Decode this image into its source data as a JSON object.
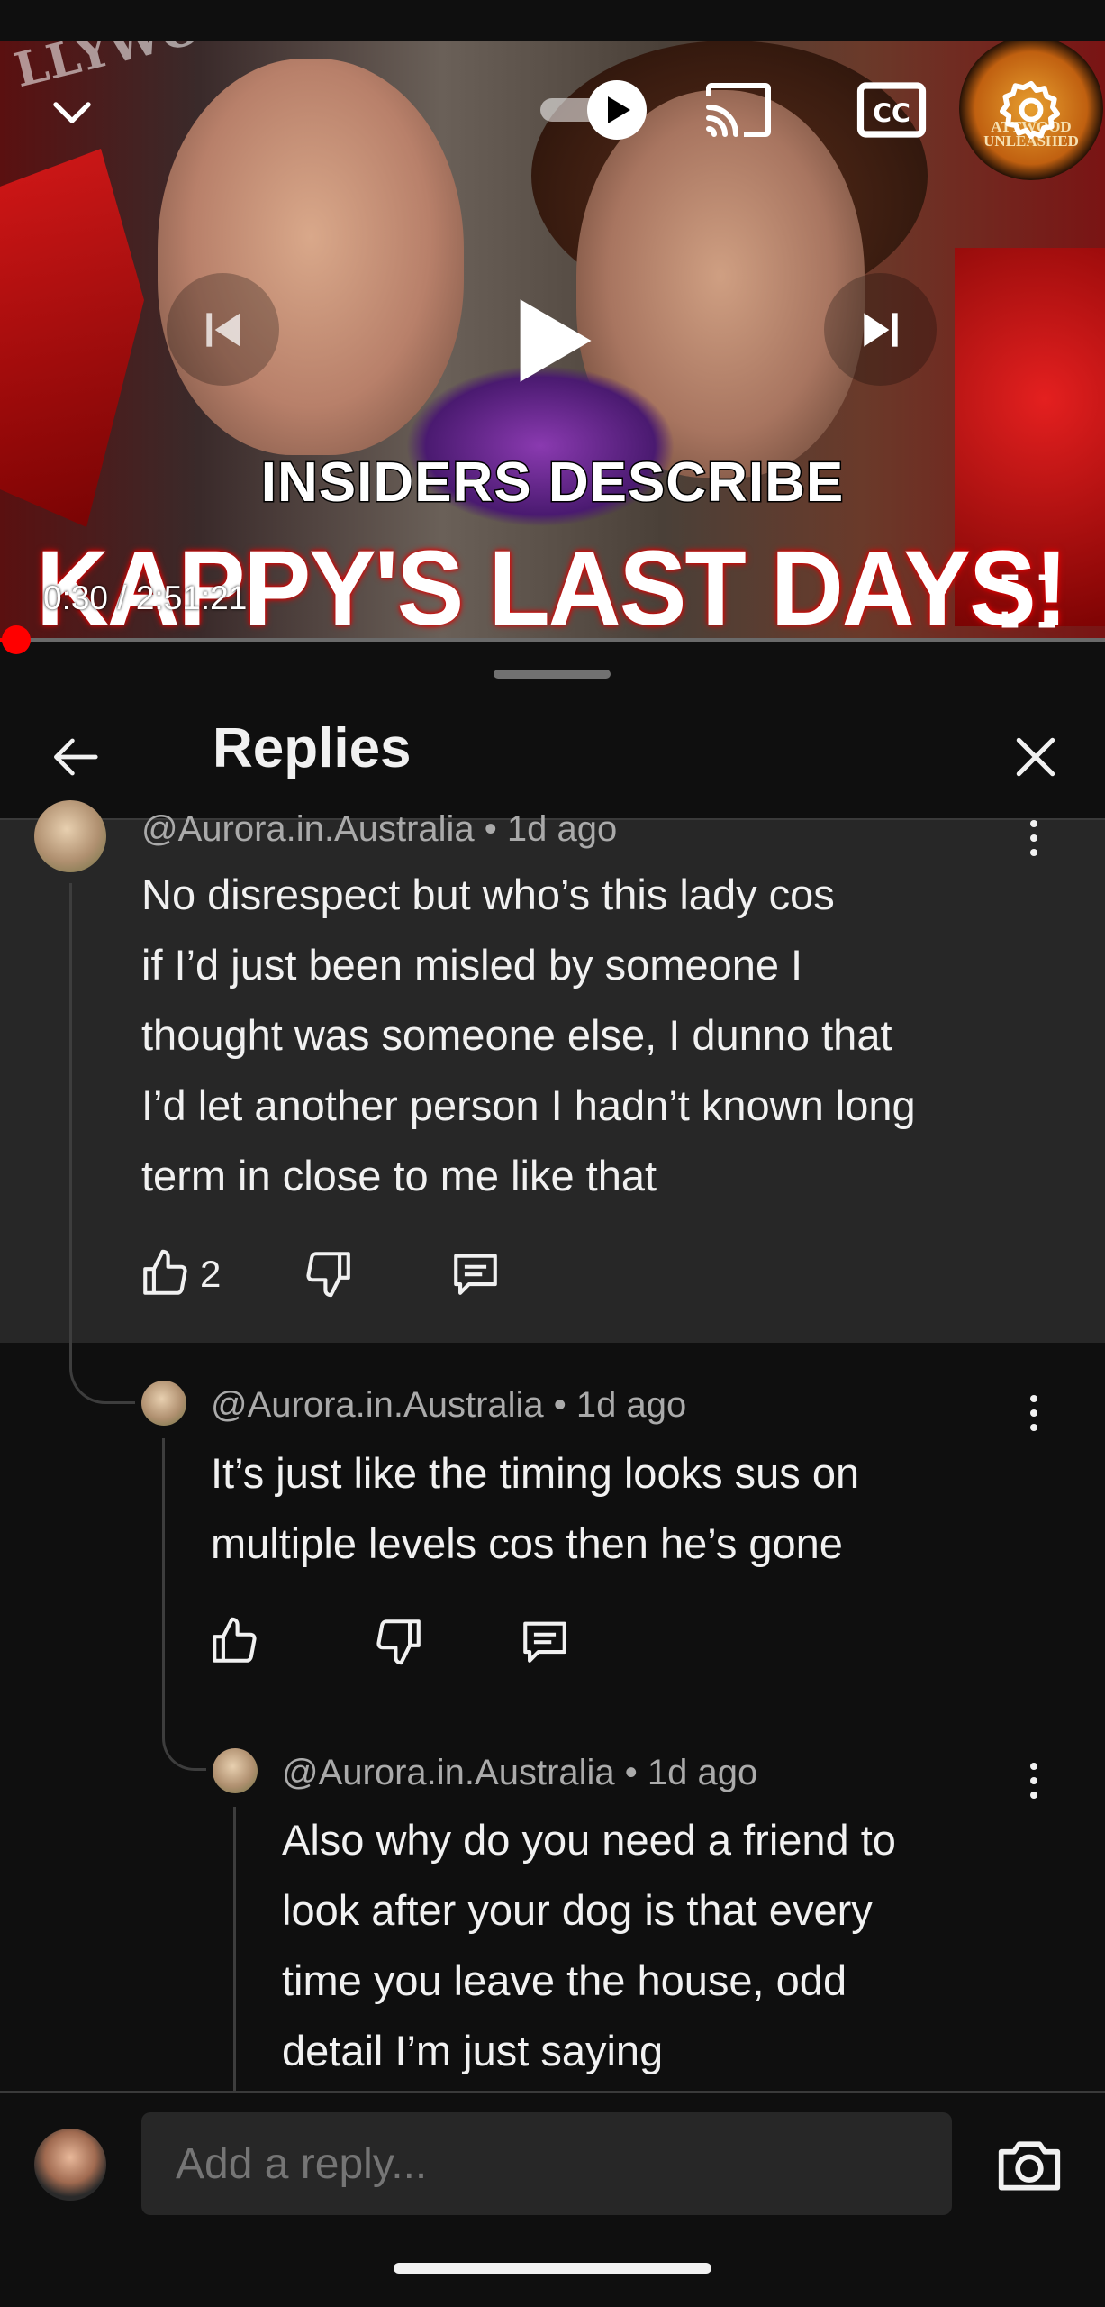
{
  "player": {
    "thumbnail_headline_1": "INSIDERS DESCRIBE",
    "thumbnail_headline_2": "KAPPY'S LAST DAYS!",
    "thumbnail_logo_text": "ATTWOOD UNLEASHED",
    "thumbnail_bg_text": "LLYWOOD",
    "time_display": "0:30 / 2:51:21",
    "progress_fraction": 0.003,
    "progress_color": "#ff0000",
    "icons": [
      "chevron-down-icon",
      "autoplay-toggle-icon",
      "cast-icon",
      "captions-icon",
      "settings-icon",
      "previous-icon",
      "play-icon",
      "next-icon",
      "fullscreen-icon"
    ]
  },
  "header": {
    "title": "Replies",
    "back_icon": "arrow-left-icon",
    "close_icon": "close-icon"
  },
  "comments": [
    {
      "handle": "@Aurora.in.Australia",
      "meta": "• 1d ago",
      "text_lines": [
        "No disrespect but who’s this lady cos",
        "if I’d just been misled by someone I",
        "thought was someone else, I dunno that",
        "I’d let another person I hadn’t known long",
        "term in close to me like that"
      ],
      "likes": "2"
    },
    {
      "handle": "@Aurora.in.Australia",
      "meta": "• 1d ago",
      "text_lines": [
        "It’s just like the timing looks sus on",
        "multiple levels cos then he’s gone"
      ],
      "likes": ""
    },
    {
      "handle": "@Aurora.in.Australia",
      "meta": "• 1d ago",
      "text_lines": [
        "Also why do you need a friend to",
        "look after your dog is that every",
        "time you leave the house, odd",
        "detail I’m just saying"
      ],
      "likes": ""
    }
  ],
  "reply_bar": {
    "placeholder": "Add a reply...",
    "camera_icon": "camera-icon"
  }
}
